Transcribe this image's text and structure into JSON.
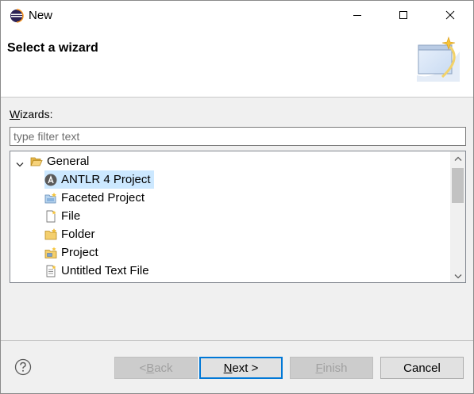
{
  "window": {
    "title": "New",
    "controls": {
      "minimize": "minimize",
      "maximize": "maximize",
      "close": "close"
    }
  },
  "banner": {
    "title": "Select a wizard"
  },
  "wizards": {
    "label_prefix": "W",
    "label_rest": "izards:",
    "filter_placeholder": "type filter text",
    "filter_value": ""
  },
  "tree": {
    "category": {
      "label": "General",
      "expanded": true
    },
    "items": [
      {
        "label": "ANTLR 4 Project",
        "icon": "antlr-icon",
        "selected": true
      },
      {
        "label": "Faceted Project",
        "icon": "faceted-project-icon",
        "selected": false
      },
      {
        "label": "File",
        "icon": "file-icon",
        "selected": false
      },
      {
        "label": "Folder",
        "icon": "folder-icon",
        "selected": false
      },
      {
        "label": "Project",
        "icon": "project-icon",
        "selected": false
      },
      {
        "label": "Untitled Text File",
        "icon": "text-file-icon",
        "selected": false
      }
    ]
  },
  "buttons": {
    "back_prefix": "< ",
    "back_mnemonic": "B",
    "back_rest": "ack",
    "next_mnemonic": "N",
    "next_rest": "ext >",
    "finish_mnemonic": "F",
    "finish_rest": "inish",
    "cancel": "Cancel"
  },
  "colors": {
    "selection": "#cce8ff",
    "default_button_border": "#0078d7"
  }
}
